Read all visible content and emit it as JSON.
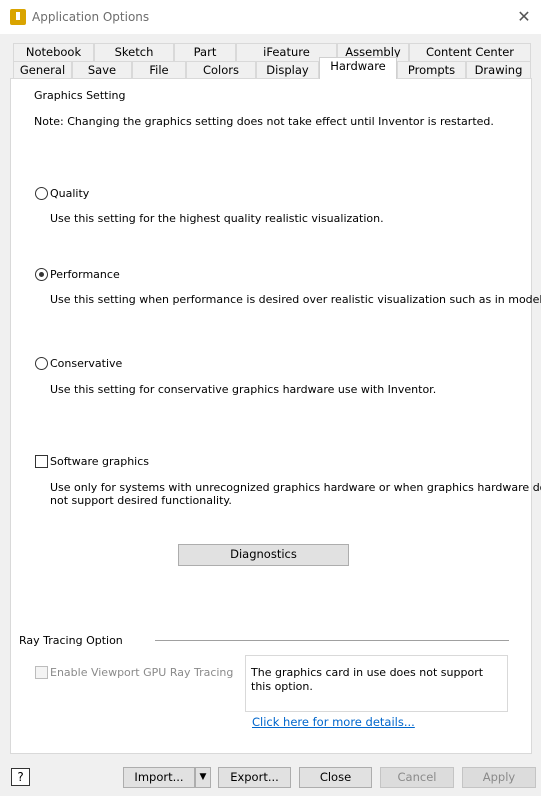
{
  "window": {
    "title": "Application Options"
  },
  "tabs_back": [
    "Notebook",
    "Sketch",
    "Part",
    "iFeature",
    "Assembly",
    "Content Center"
  ],
  "tabs_front": [
    "General",
    "Save",
    "File",
    "Colors",
    "Display",
    "Hardware",
    "Prompts",
    "Drawing"
  ],
  "active_tab": "Hardware",
  "graphics": {
    "group_label": "Graphics Setting",
    "note": "Note: Changing the graphics setting does not take effect until Inventor is restarted.",
    "quality_label": "Quality",
    "quality_desc": "Use this setting for the highest quality realistic visualization.",
    "performance_label": "Performance",
    "performance_desc": "Use this setting when performance is desired over realistic visualization such as in modeling.",
    "conservative_label": "Conservative",
    "conservative_desc": "Use this setting for conservative graphics hardware use with Inventor.",
    "software_label": "Software graphics",
    "software_desc_1": "Use only for systems with unrecognized graphics hardware or when graphics hardware does",
    "software_desc_2": "not support desired functionality.",
    "diagnostics_label": "Diagnostics",
    "selected": "Performance"
  },
  "ray_tracing": {
    "group_label": "Ray Tracing Option",
    "checkbox_label": "Enable Viewport GPU Ray Tracing",
    "info": "The graphics card in use does not support this option.",
    "link": "Click here for more details..."
  },
  "footer": {
    "help": "?",
    "import": "Import...",
    "export": "Export...",
    "close": "Close",
    "cancel": "Cancel",
    "apply": "Apply"
  }
}
